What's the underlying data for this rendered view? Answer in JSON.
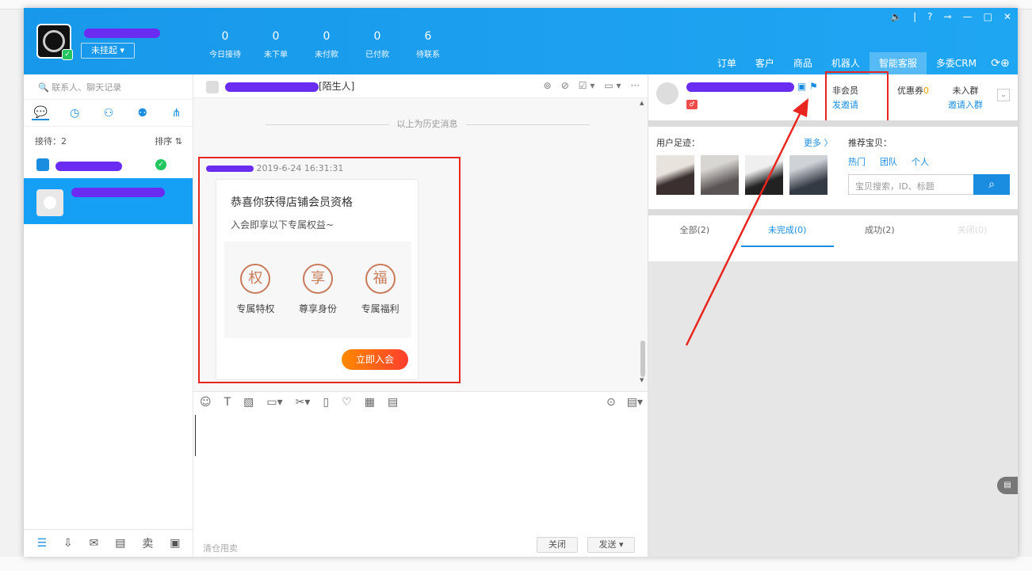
{
  "window": {
    "controls": [
      "🔈",
      "|",
      "?",
      "⊸",
      "—",
      "□",
      "✕"
    ]
  },
  "user": {
    "status": "未挂起 ▾"
  },
  "stats": [
    {
      "value": "0",
      "label": "今日接待"
    },
    {
      "value": "0",
      "label": "未下单"
    },
    {
      "value": "0",
      "label": "未付款"
    },
    {
      "value": "0",
      "label": "已付款"
    },
    {
      "value": "6",
      "label": "待联系"
    }
  ],
  "topnav": [
    "订单",
    "客户",
    "商品",
    "机器人",
    "智能客服",
    "多委CRM"
  ],
  "topnav_active": "智能客服",
  "left": {
    "search_placeholder": "联系人、聊天记录",
    "queue_label": "接待：2",
    "sort_label": "排序 ⇅"
  },
  "chat": {
    "peer_tag": "[陌生人]",
    "history_label": "以上为历史消息",
    "msg_time": "2019-6-24 16:31:31",
    "card": {
      "title": "恭喜你获得店铺会员资格",
      "subtitle": "入会即享以下专属权益~",
      "perks": [
        {
          "icon": "权",
          "label": "专属特权"
        },
        {
          "icon": "享",
          "label": "尊享身份"
        },
        {
          "icon": "福",
          "label": "专属福利"
        }
      ],
      "join_label": "立即入会"
    },
    "input_hint": "清仓甩卖",
    "close_label": "关闭",
    "send_label": "发送 ▾"
  },
  "right": {
    "member_status": "非会员",
    "member_action": "发邀请",
    "coupon_label": "优惠券",
    "coupon_count": "0",
    "group_status": "未入群",
    "group_action": "邀请入群",
    "footprint_label": "用户足迹：",
    "more_label": "更多 〉",
    "recommend_label": "推荐宝贝：",
    "rec_tabs": [
      "热门",
      "团队",
      "个人"
    ],
    "rec_search_placeholder": "宝贝搜索，ID、标题",
    "order_tabs": [
      "全部(2)",
      "未完成(0)",
      "成功(2)",
      "关闭(0)"
    ]
  },
  "colors": {
    "accent": "#1a8de0",
    "header": "#1da1f2",
    "annotation": "#e8261f"
  }
}
